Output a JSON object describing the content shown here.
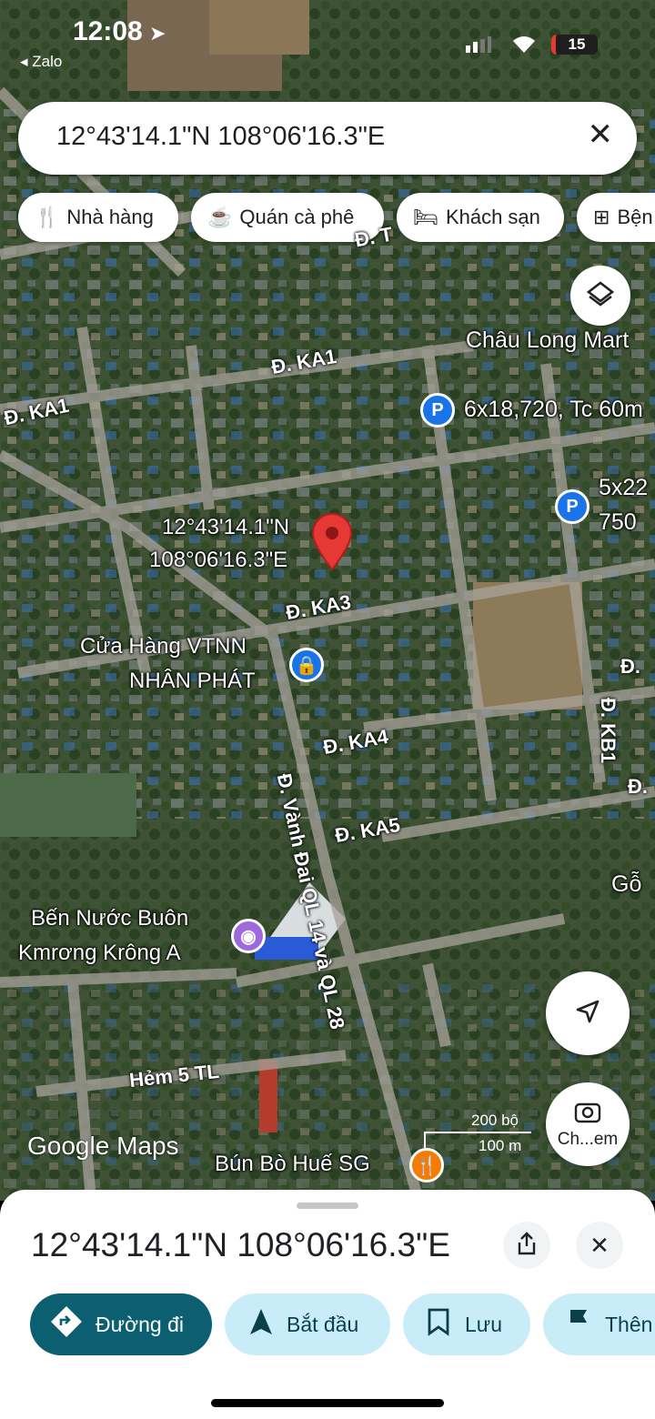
{
  "status_bar": {
    "time": "12:08",
    "back_app": "◂ Zalo",
    "battery": "15"
  },
  "search": {
    "query": "12°43'14.1\"N 108°06'16.3\"E",
    "clear_icon": "close-icon"
  },
  "chips": [
    {
      "label": "Nhà hàng",
      "icon": "restaurant-icon"
    },
    {
      "label": "Quán cà phê",
      "icon": "coffee-icon"
    },
    {
      "label": "Khách sạn",
      "icon": "hotel-icon"
    },
    {
      "label": "Bện",
      "icon": "hospital-icon"
    }
  ],
  "map": {
    "pin_label_line1": "12°43'14.1\"N",
    "pin_label_line2": "108°06'16.3\"E",
    "roads": [
      "Đ. KA1",
      "Đ. KA1",
      "Đ. KA3",
      "Đ. KA4",
      "Đ. KA5",
      "Đ. Vành Đai QL 14 và QL 28",
      "Hẻm 5 TL",
      "Đ. KB1",
      "Đ. T",
      "Đ. ",
      "Đ."
    ],
    "places": {
      "chau_long": "Châu Long Mart",
      "parking1": "6x18,720, Tc 60m",
      "parking2_line1": "5x22",
      "parking2_line2": "750",
      "store_line1": "Cửa Hàng VTNN",
      "store_line2": "NHÂN PHÁT",
      "ben_nuoc_line1": "Bến Nước Buôn",
      "ben_nuoc_line2": "Kmrơng Krông A",
      "bun_bo": "Bún Bò Huế SG",
      "go": "Gỗ"
    },
    "scale": {
      "imperial": "200 bộ",
      "metric": "100 m"
    },
    "logo": "Google Maps",
    "camera_label": "Ch...em"
  },
  "sheet": {
    "title": "12°43'14.1\"N 108°06'16.3\"E",
    "buttons": [
      {
        "label": "Đường đi",
        "icon": "directions-icon"
      },
      {
        "label": "Bắt đầu",
        "icon": "navigation-arrow-icon"
      },
      {
        "label": "Lưu",
        "icon": "bookmark-icon"
      },
      {
        "label": "Thên",
        "icon": "flag-icon"
      }
    ]
  },
  "colors": {
    "primary_button": "#0b5f70",
    "secondary_button": "#c9edf8",
    "pin": "#e53935",
    "parking": "#1a73e8",
    "shop": "#1a73e8",
    "attraction": "#9c6ade",
    "restaurant": "#f57c00"
  }
}
